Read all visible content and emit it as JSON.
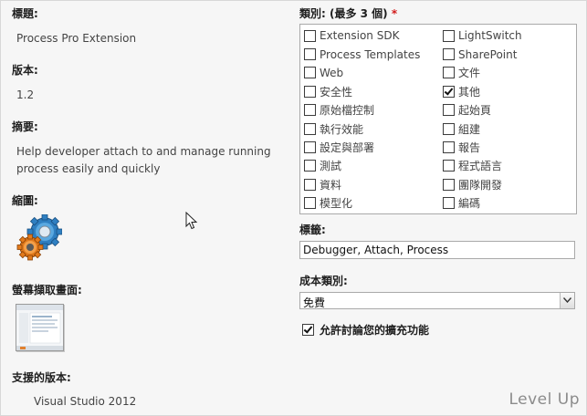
{
  "form": {
    "title_label": "標題:",
    "title_value": "Process Pro Extension",
    "version_label": "版本:",
    "version_value": "1.2",
    "summary_label": "摘要:",
    "summary_value": "Help developer attach to and manage running process easily and quickly",
    "thumbnail_label": "縮圖:",
    "screenshot_label": "螢幕擷取畫面:",
    "supported_label": "支援的版本:",
    "supported_value": "Visual Studio 2012"
  },
  "categories": {
    "label": "類別: (最多 3 個)",
    "required_mark": "*",
    "left": [
      {
        "label": "Extension SDK",
        "checked": false
      },
      {
        "label": "Process Templates",
        "checked": false
      },
      {
        "label": "Web",
        "checked": false
      },
      {
        "label": "安全性",
        "checked": false
      },
      {
        "label": "原始檔控制",
        "checked": false
      },
      {
        "label": "執行效能",
        "checked": false
      },
      {
        "label": "設定與部署",
        "checked": false
      },
      {
        "label": "測試",
        "checked": false
      },
      {
        "label": "資料",
        "checked": false
      },
      {
        "label": "模型化",
        "checked": false
      }
    ],
    "right": [
      {
        "label": "LightSwitch",
        "checked": false
      },
      {
        "label": "SharePoint",
        "checked": false
      },
      {
        "label": "文件",
        "checked": false
      },
      {
        "label": "其他",
        "checked": true
      },
      {
        "label": "起始頁",
        "checked": false
      },
      {
        "label": "組建",
        "checked": false
      },
      {
        "label": "報告",
        "checked": false
      },
      {
        "label": "程式語言",
        "checked": false
      },
      {
        "label": "團隊開發",
        "checked": false
      },
      {
        "label": "編碼",
        "checked": false
      }
    ]
  },
  "tags": {
    "label": "標籤:",
    "value": "Debugger, Attach, Process"
  },
  "cost": {
    "label": "成本類別:",
    "value": "免費"
  },
  "qa": {
    "label": "允許討論您的擴充功能",
    "checked": true
  },
  "watermark": "Level Up",
  "icons": {
    "thumbnail": "gears-icon",
    "screenshot": "screenshot-thumbnail",
    "cursor": "mouse-cursor-icon"
  }
}
